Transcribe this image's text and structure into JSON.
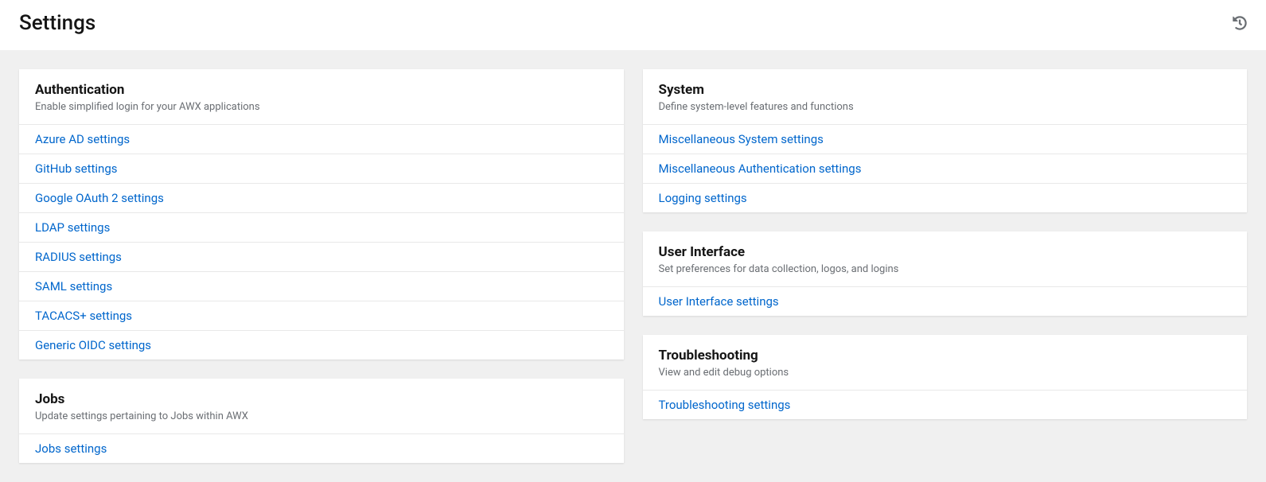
{
  "header": {
    "title": "Settings"
  },
  "columns": {
    "left": [
      {
        "id": "authentication",
        "title": "Authentication",
        "description": "Enable simplified login for your AWX applications",
        "links": [
          {
            "id": "azure-ad",
            "label": "Azure AD settings"
          },
          {
            "id": "github",
            "label": "GitHub settings"
          },
          {
            "id": "google-oauth2",
            "label": "Google OAuth 2 settings"
          },
          {
            "id": "ldap",
            "label": "LDAP settings"
          },
          {
            "id": "radius",
            "label": "RADIUS settings"
          },
          {
            "id": "saml",
            "label": "SAML settings"
          },
          {
            "id": "tacacs",
            "label": "TACACS+ settings"
          },
          {
            "id": "oidc",
            "label": "Generic OIDC settings"
          }
        ]
      },
      {
        "id": "jobs",
        "title": "Jobs",
        "description": "Update settings pertaining to Jobs within AWX",
        "links": [
          {
            "id": "jobs-settings",
            "label": "Jobs settings"
          }
        ]
      }
    ],
    "right": [
      {
        "id": "system",
        "title": "System",
        "description": "Define system-level features and functions",
        "links": [
          {
            "id": "misc-system",
            "label": "Miscellaneous System settings"
          },
          {
            "id": "misc-auth",
            "label": "Miscellaneous Authentication settings"
          },
          {
            "id": "logging",
            "label": "Logging settings"
          }
        ]
      },
      {
        "id": "user-interface",
        "title": "User Interface",
        "description": "Set preferences for data collection, logos, and logins",
        "links": [
          {
            "id": "ui-settings",
            "label": "User Interface settings"
          }
        ]
      },
      {
        "id": "troubleshooting",
        "title": "Troubleshooting",
        "description": "View and edit debug options",
        "links": [
          {
            "id": "troubleshooting-settings",
            "label": "Troubleshooting settings"
          }
        ]
      }
    ]
  }
}
